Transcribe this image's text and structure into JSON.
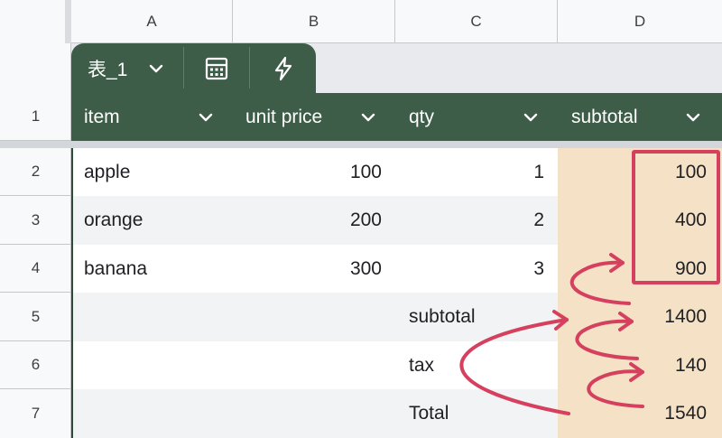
{
  "columns": [
    "A",
    "B",
    "C",
    "D"
  ],
  "rows": [
    "1",
    "2",
    "3",
    "4",
    "5",
    "6",
    "7"
  ],
  "table": {
    "name": "表_1"
  },
  "headers": [
    "item",
    "unit price",
    "qty",
    "subtotal"
  ],
  "body": [
    [
      "apple",
      "100",
      "1",
      "100"
    ],
    [
      "orange",
      "200",
      "2",
      "400"
    ],
    [
      "banana",
      "300",
      "3",
      "900"
    ]
  ],
  "summary": [
    {
      "label": "subtotal",
      "value": "1400"
    },
    {
      "label": "tax",
      "value": "140"
    },
    {
      "label": "Total",
      "value": "1540"
    }
  ],
  "icons": [
    "chevron-down-icon",
    "calculator-icon",
    "lightning-icon"
  ],
  "colors": {
    "table_header": "#3e5d48",
    "subtotal_column": "#f5e1c6",
    "annotation": "#d6405f"
  }
}
